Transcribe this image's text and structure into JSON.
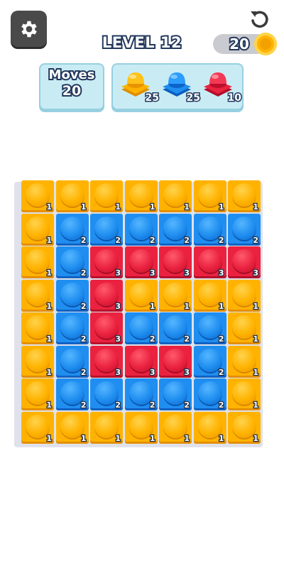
{
  "level": {
    "title": "LEVEL 12"
  },
  "coins": {
    "count": "20",
    "accent": "#ffb300"
  },
  "moves": {
    "label": "Moves",
    "value": "20"
  },
  "goals": [
    {
      "name": "yellow-button",
      "color": "#ffb300",
      "count": "25"
    },
    {
      "name": "blue-button",
      "color": "#1f8ef0",
      "count": "25"
    },
    {
      "name": "red-button",
      "color": "#ea2240",
      "count": "10"
    }
  ],
  "colors": {
    "yellow": "#ffb300",
    "blue": "#1f8ef0",
    "red": "#ea2240"
  },
  "icons": {
    "settings": "gear-icon",
    "restart": "restart-icon",
    "coin": "coin-icon"
  },
  "grid": [
    [
      1,
      1,
      1,
      1,
      1,
      1,
      1
    ],
    [
      1,
      2,
      2,
      2,
      2,
      2,
      2
    ],
    [
      1,
      2,
      3,
      3,
      3,
      3,
      3
    ],
    [
      1,
      2,
      3,
      1,
      1,
      1,
      1
    ],
    [
      1,
      2,
      3,
      2,
      2,
      2,
      1
    ],
    [
      1,
      2,
      3,
      3,
      3,
      2,
      1
    ],
    [
      1,
      2,
      2,
      2,
      2,
      2,
      1
    ],
    [
      1,
      1,
      1,
      1,
      1,
      1,
      1
    ]
  ]
}
